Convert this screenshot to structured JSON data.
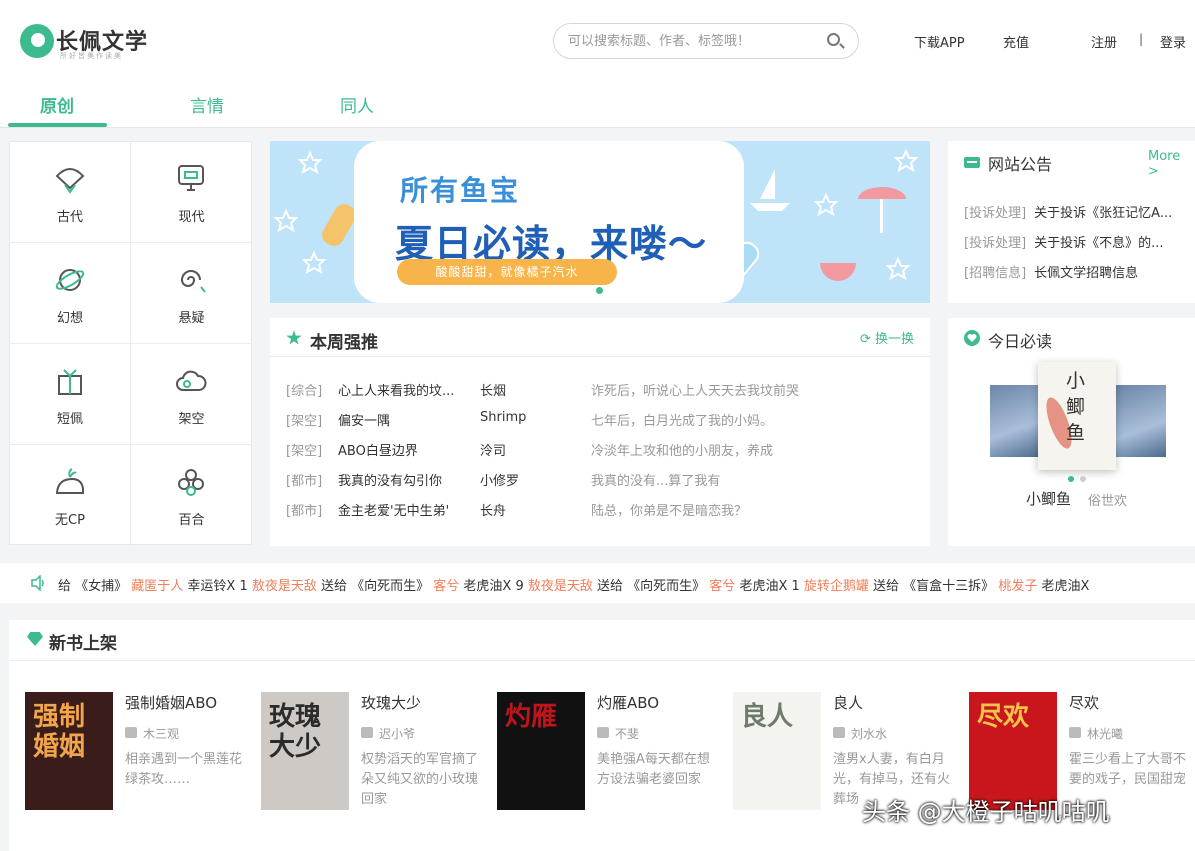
{
  "header": {
    "logo_name": "长佩文学",
    "logo_slogan": "所好皆美作读美",
    "search_placeholder": "可以搜索标题、作者、标签哦！",
    "download_app": "下载APP",
    "recharge": "充值",
    "register": "注册",
    "separator": "|",
    "login": "登录"
  },
  "nav": {
    "tabs": [
      "原创",
      "言情",
      "同人"
    ],
    "active": "原创"
  },
  "categories": [
    "古代",
    "现代",
    "幻想",
    "悬疑",
    "短佩",
    "架空",
    "无CP",
    "百合"
  ],
  "banner": {
    "line1": "所有鱼宝",
    "line2": "夏日必读，来喽～",
    "line3": "酸酸甜甜，就像橘子汽水"
  },
  "weekly": {
    "title": "本周强推",
    "refresh": "换一换",
    "rows": [
      {
        "tag": "[综合]",
        "title": "心上人来看我的坟...",
        "author": "长烟",
        "desc": "诈死后，听说心上人天天去我坟前哭"
      },
      {
        "tag": "[架空]",
        "title": "偏安一隅",
        "author": "Shrimp",
        "desc": "七年后，白月光成了我的小妈。"
      },
      {
        "tag": "[架空]",
        "title": "ABO白昼边界",
        "author": "泠司",
        "desc": "冷淡年上攻和他的小朋友，养成"
      },
      {
        "tag": "[都市]",
        "title": "我真的没有勾引你",
        "author": "小修罗",
        "desc": "我真的没有...算了我有"
      },
      {
        "tag": "[都市]",
        "title": "金主老爱'无中生弟'",
        "author": "长舟",
        "desc": "陆总，你弟是不是暗恋我？"
      }
    ]
  },
  "notice": {
    "title": "网站公告",
    "more": "More >",
    "items": [
      {
        "tag": "[投诉处理]",
        "text": "关于投诉《张狂记忆A..."
      },
      {
        "tag": "[投诉处理]",
        "text": "关于投诉《不息》的..."
      },
      {
        "tag": "[招聘信息]",
        "text": "长佩文学招聘信息"
      }
    ]
  },
  "must_read": {
    "title": "今日必读",
    "cover_text": "小鲫鱼",
    "book_title": "小鲫鱼",
    "author": "俗世欢"
  },
  "ticker": {
    "segments": [
      {
        "t": "给 《女捕》 ",
        "h": false
      },
      {
        "t": "藏匿于人",
        "h": true
      },
      {
        "t": " 幸运铃X 1 ",
        "h": false
      },
      {
        "t": "敖夜是天敌",
        "h": true
      },
      {
        "t": " 送给 《向死而生》 ",
        "h": false
      },
      {
        "t": "客兮",
        "h": true
      },
      {
        "t": " 老虎油X 9 ",
        "h": false
      },
      {
        "t": "敖夜是天敌",
        "h": true
      },
      {
        "t": " 送给 《向死而生》 ",
        "h": false
      },
      {
        "t": "客兮",
        "h": true
      },
      {
        "t": " 老虎油X 1 ",
        "h": false
      },
      {
        "t": "旋转企鹅罐",
        "h": true
      },
      {
        "t": " 送给 《盲盒十三拆》 ",
        "h": false
      },
      {
        "t": "桃发子",
        "h": true
      },
      {
        "t": " 老虎油X",
        "h": false
      }
    ]
  },
  "new_books": {
    "title": "新书上架",
    "books": [
      {
        "title": "强制婚姻ABO",
        "author": "木三观",
        "desc": "相亲遇到一个黑莲花绿茶攻……",
        "cover_text": "强制婚姻",
        "cover_bg": "#3a1d1a",
        "cover_fg": "#f2a54a"
      },
      {
        "title": "玫瑰大少",
        "author": "迟小爷",
        "desc": "权势滔天的军官摘了朵又纯又欲的小玫瑰回家",
        "cover_text": "玫瑰大少",
        "cover_bg": "#cfc9c6",
        "cover_fg": "#2b2b2b"
      },
      {
        "title": "灼雁ABO",
        "author": "不斐",
        "desc": "美艳强A每天都在想方设法骗老婆回家",
        "cover_text": "灼雁",
        "cover_bg": "#111111",
        "cover_fg": "#c0141c"
      },
      {
        "title": "良人",
        "author": "刘水水",
        "desc": "渣男x人妻，有白月光，有掉马，还有火葬场",
        "cover_text": "良人",
        "cover_bg": "#f3f3ef",
        "cover_fg": "#6f7b6a"
      },
      {
        "title": "尽欢",
        "author": "林光曦",
        "desc": "霍三少看上了大哥不要的戏子，民国甜宠",
        "cover_text": "尽欢",
        "cover_bg": "#c9161c",
        "cover_fg": "#f5c44a"
      }
    ]
  },
  "watermark": "头条 @大橙子咕叽咕叽",
  "colors": {
    "accent": "#3dbb8f",
    "highlight": "#f07f5c",
    "muted": "#999999"
  }
}
